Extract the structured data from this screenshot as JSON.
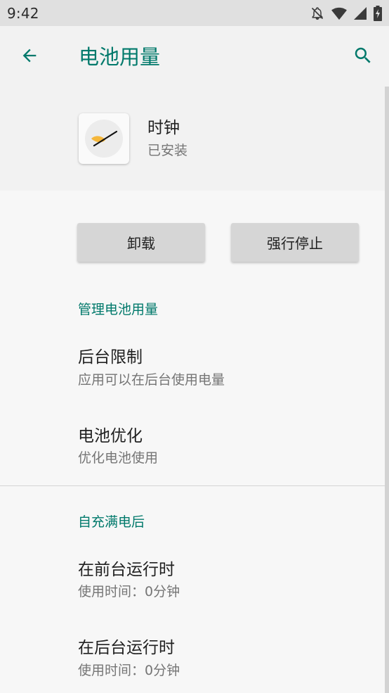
{
  "status_bar": {
    "time": "9:42",
    "icons": [
      "notifications-off-icon",
      "wifi-icon",
      "cellular-signal-icon",
      "battery-charging-icon"
    ]
  },
  "app_bar": {
    "title": "电池用量",
    "back_icon": "arrow-back-icon",
    "search_icon": "search-icon",
    "accent_color": "#00796b"
  },
  "app_header": {
    "name": "时钟",
    "status": "已安装",
    "icon": "clock-app-icon"
  },
  "actions": {
    "uninstall_label": "卸载",
    "force_stop_label": "强行停止"
  },
  "manage_section": {
    "header": "管理电池用量",
    "items": [
      {
        "title": "后台限制",
        "summary": "应用可以在后台使用电量"
      },
      {
        "title": "电池优化",
        "summary": "优化电池使用"
      }
    ]
  },
  "since_full_charge": {
    "header": "自充满电后",
    "items": [
      {
        "title": "在前台运行时",
        "summary": "使用时间：0分钟"
      },
      {
        "title": "在后台运行时",
        "summary": "使用时间：0分钟"
      }
    ]
  }
}
